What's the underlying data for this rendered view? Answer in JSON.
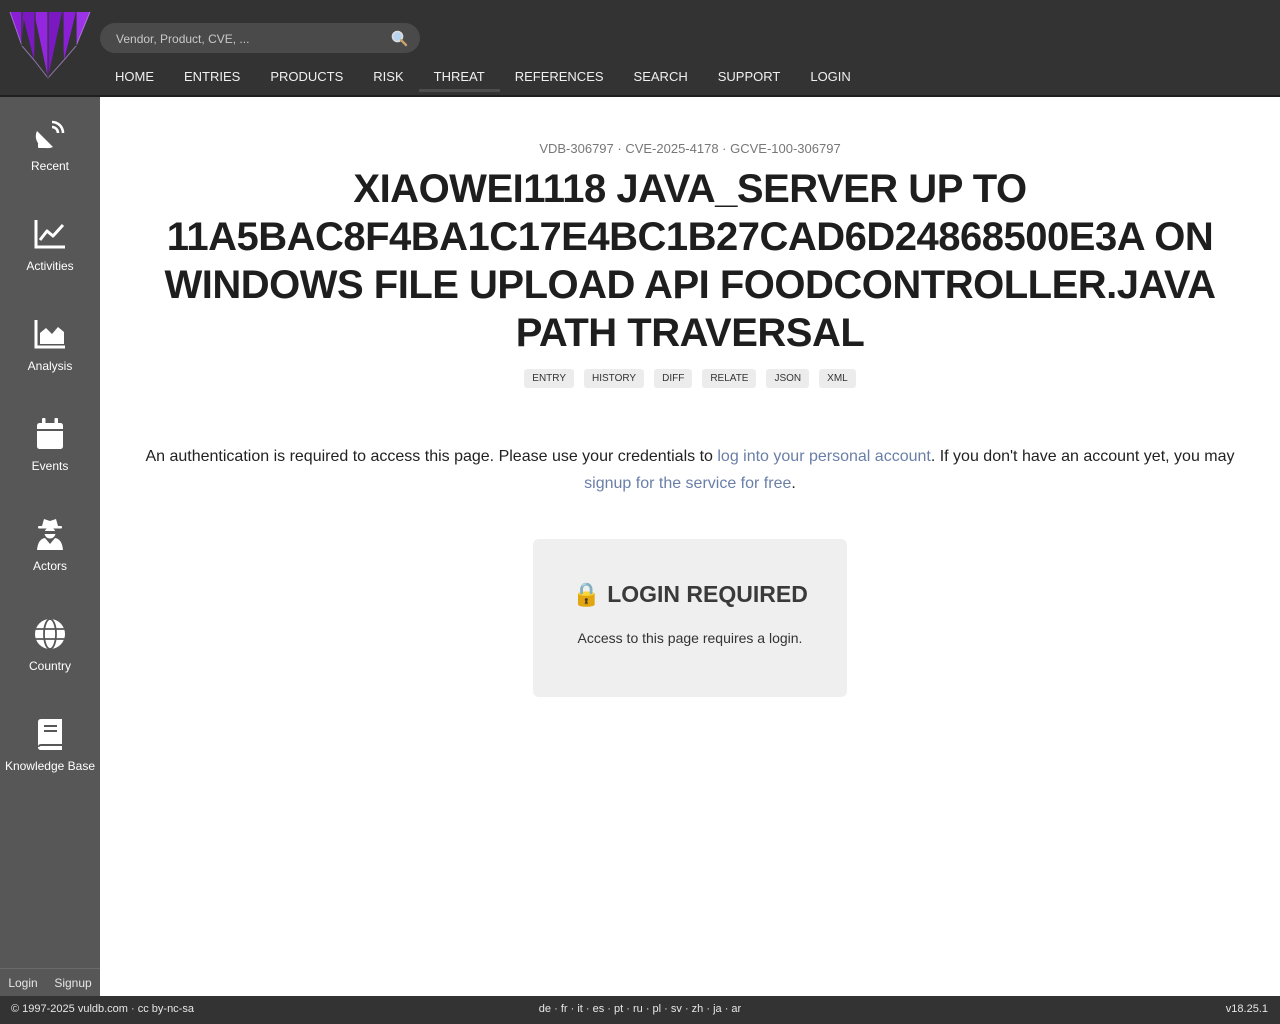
{
  "header": {
    "search_placeholder": "Vendor, Product, CVE, ...",
    "nav": [
      "HOME",
      "ENTRIES",
      "PRODUCTS",
      "RISK",
      "THREAT",
      "REFERENCES",
      "SEARCH",
      "SUPPORT",
      "LOGIN"
    ],
    "active_nav": "THREAT"
  },
  "sidebar": {
    "items": [
      {
        "label": "Recent",
        "icon": "satellite-dish-icon"
      },
      {
        "label": "Activities",
        "icon": "line-chart-icon"
      },
      {
        "label": "Analysis",
        "icon": "area-chart-icon"
      },
      {
        "label": "Events",
        "icon": "calendar-icon"
      },
      {
        "label": "Actors",
        "icon": "user-secret-icon"
      },
      {
        "label": "Country",
        "icon": "globe-icon"
      },
      {
        "label": "Knowledge Base",
        "icon": "book-icon"
      }
    ],
    "footer_login": "Login",
    "footer_signup": "Signup"
  },
  "main": {
    "ids": "VDB-306797 · CVE-2025-4178 · GCVE-100-306797",
    "title": "XIAOWEI1118 JAVA_SERVER UP TO 11A5BAC8F4BA1C17E4BC1B27CAD6D24868500E3A ON WINDOWS FILE UPLOAD API FOODCONTROLLER.JAVA PATH TRAVERSAL",
    "tabs": [
      "ENTRY",
      "HISTORY",
      "DIFF",
      "RELATE",
      "JSON",
      "XML"
    ],
    "auth_text_1": "An authentication is required to access this page. Please use your credentials to ",
    "auth_link_1": "log into your personal account",
    "auth_text_2": ". If you don't have an account yet, you may ",
    "auth_link_2": "signup for the service for free",
    "auth_text_3": ".",
    "login_box_title": "🔒 LOGIN REQUIRED",
    "login_box_text": "Access to this page requires a login."
  },
  "footer": {
    "copyright": "© 1997-2025 vuldb.com · cc by-nc-sa",
    "languages": [
      "de",
      "fr",
      "it",
      "es",
      "pt",
      "ru",
      "pl",
      "sv",
      "zh",
      "ja",
      "ar"
    ],
    "version": "v18.25.1"
  },
  "colors": {
    "header_bg": "#333333",
    "sidebar_bg": "#575757",
    "logo_purple": "#8a1fd6",
    "link": "#6a7fa8"
  }
}
